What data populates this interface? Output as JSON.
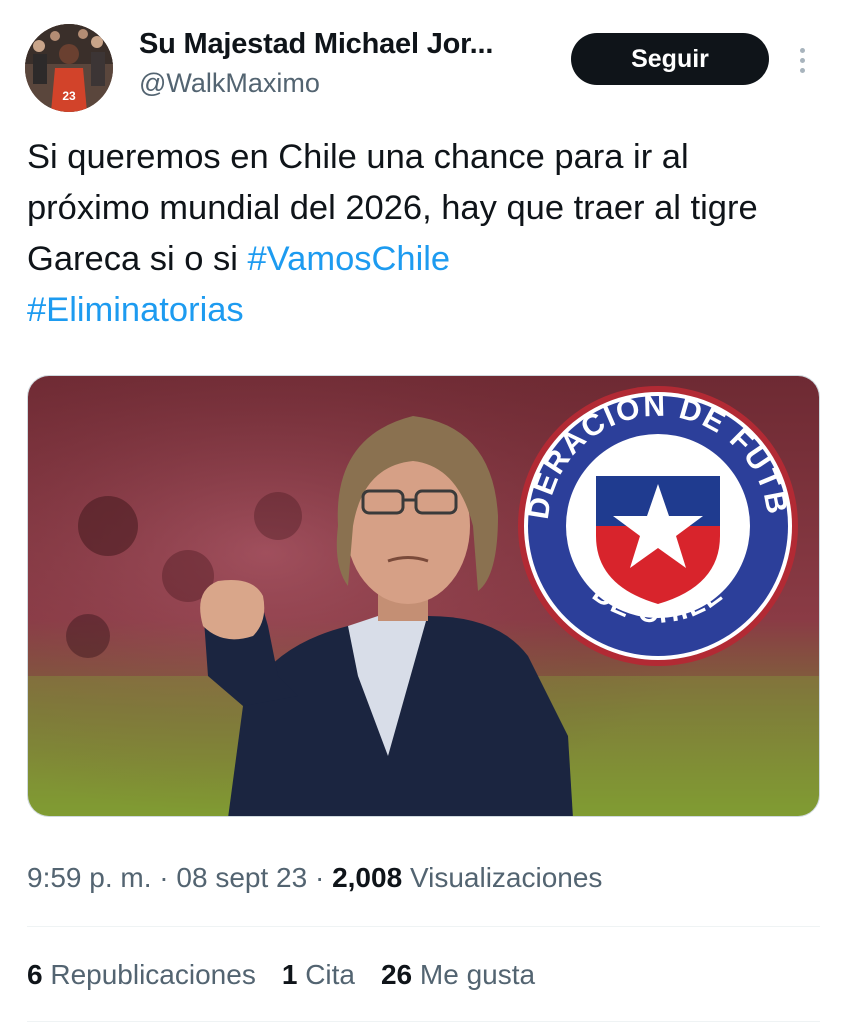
{
  "author": {
    "display_name": "Su Majestad Michael Jor...",
    "handle": "@WalkMaximo",
    "avatar_jersey_number": "23"
  },
  "follow_label": "Seguir",
  "tweet": {
    "text_plain": "Si queremos en Chile una chance para ir al próximo mundial del 2026, hay que traer al tigre  Gareca si o si ",
    "hashtags": [
      "#VamosChile",
      "#Eliminatorias"
    ]
  },
  "media": {
    "logo_top_text": "FEDERACION DE FUTBOL",
    "logo_bottom_text": "DE CHILE"
  },
  "meta": {
    "time": "9:59 p. m.",
    "date": "08 sept 23",
    "views_count": "2,008",
    "views_label": "Visualizaciones",
    "separator": "·"
  },
  "stats": {
    "reposts_count": "6",
    "reposts_label": "Republicaciones",
    "quotes_count": "1",
    "quotes_label": "Cita",
    "likes_count": "26",
    "likes_label": "Me gusta"
  },
  "colors": {
    "link": "#1d9bf0",
    "text": "#0f1419",
    "secondary": "#536471",
    "button_bg": "#0f1419"
  }
}
